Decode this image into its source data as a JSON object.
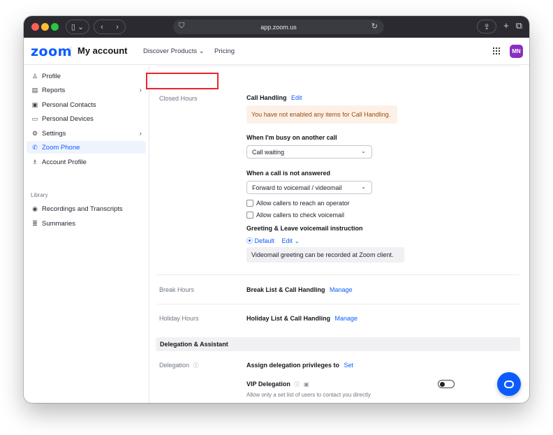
{
  "browser": {
    "url": "app.zoom.us",
    "sidebar_icon": "sidebar-icon",
    "back_glyph": "‹",
    "forward_glyph": "›",
    "share_glyph": "⇪",
    "new_tab_glyph": "+",
    "tabs_glyph": "⧉"
  },
  "header": {
    "logo": "zoom",
    "title": "My account",
    "discover": "Discover Products ⌄",
    "pricing": "Pricing",
    "avatar": "MN"
  },
  "sidebar": {
    "items": [
      {
        "label": "Profile",
        "icon": "person-icon"
      },
      {
        "label": "Reports",
        "icon": "reports-icon",
        "chevron": "›"
      },
      {
        "label": "Personal Contacts",
        "icon": "contacts-icon"
      },
      {
        "label": "Personal Devices",
        "icon": "devices-icon"
      },
      {
        "label": "Settings",
        "icon": "gear-icon",
        "chevron": "›"
      },
      {
        "label": "Zoom Phone",
        "icon": "phone-icon"
      },
      {
        "label": "Account Profile",
        "icon": "account-profile-icon"
      }
    ],
    "section_library": "Library",
    "library_items": [
      {
        "label": "Recordings and Transcripts",
        "icon": "record-icon"
      },
      {
        "label": "Summaries",
        "icon": "summaries-icon"
      }
    ]
  },
  "main": {
    "closed_hours_label": "Closed Hours",
    "call_handling": "Call Handling",
    "edit": "Edit",
    "notice": "You have not enabled any items for Call Handling.",
    "busy_heading": "When I'm busy on another call",
    "busy_value": "Call waiting",
    "not_answered_heading": "When a call is not answered",
    "not_answered_value": "Forward to voicemail / videomail",
    "allow_operator": "Allow callers to reach an operator",
    "allow_voicemail": "Allow callers to check voicemail",
    "greeting_heading": "Greeting & Leave voicemail instruction",
    "greeting_default": "⦿ Default",
    "greeting_edit": "Edit ⌄",
    "videomail_note": "Videomail greeting can be recorded at Zoom client.",
    "break_hours_label": "Break Hours",
    "break_list": "Break List & Call Handling",
    "holiday_hours_label": "Holiday Hours",
    "holiday_list": "Holiday List & Call Handling",
    "manage": "Manage",
    "delegation_section": "Delegation & Assistant",
    "delegation_label": "Delegation",
    "assign_privileges": "Assign delegation privileges to",
    "set": "Set",
    "vip_delegation": "VIP Delegation",
    "vip_note": "Allow only a set list of users to contact you directly",
    "vip_toggle_on": false
  },
  "colors": {
    "accent": "#0b5cff",
    "highlight": "#e8262c",
    "avatar": "#8a2ec2"
  }
}
